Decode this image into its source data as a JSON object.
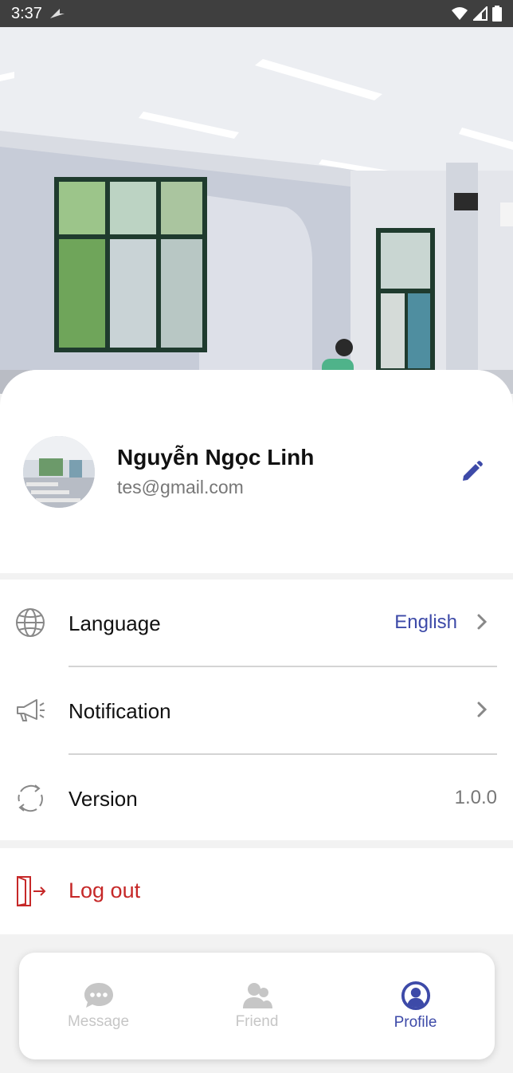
{
  "status_bar": {
    "time": "3:37"
  },
  "profile": {
    "name": "Nguyễn Ngọc Linh",
    "email": "tes@gmail.com"
  },
  "settings": {
    "language": {
      "label": "Language",
      "value": "English",
      "icon": "globe-icon"
    },
    "notification": {
      "label": "Notification",
      "icon": "megaphone-icon"
    },
    "version": {
      "label": "Version",
      "value": "1.0.0",
      "icon": "refresh-icon"
    }
  },
  "logout": {
    "label": "Log out",
    "icon": "logout-icon"
  },
  "bottom_nav": {
    "items": [
      {
        "label": "Message",
        "icon": "chat-bubble-icon",
        "active": false
      },
      {
        "label": "Friend",
        "icon": "friends-icon",
        "active": false
      },
      {
        "label": "Profile",
        "icon": "user-circle-icon",
        "active": true
      }
    ]
  },
  "colors": {
    "accent": "#3d4aa8",
    "danger": "#c62828",
    "inactive": "#c6c6c6"
  }
}
